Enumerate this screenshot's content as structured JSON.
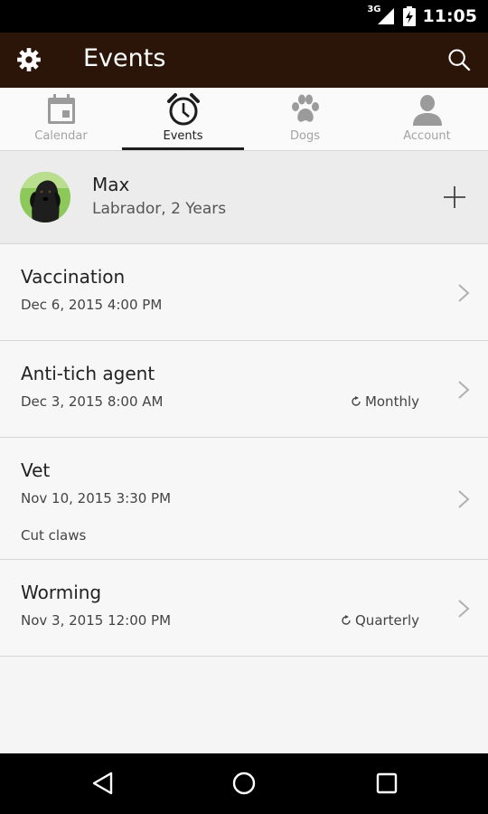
{
  "status_bar": {
    "network": "3G",
    "time": "11:05",
    "icons": [
      "signal-icon",
      "battery-charging-icon"
    ]
  },
  "app_bar": {
    "title": "Events",
    "icons": [
      "gear-icon",
      "search-icon"
    ]
  },
  "tabs": [
    {
      "label": "Calendar",
      "icon": "calendar-icon",
      "active": false
    },
    {
      "label": "Events",
      "icon": "alarm-clock-icon",
      "active": true
    },
    {
      "label": "Dogs",
      "icon": "paw-icon",
      "active": false
    },
    {
      "label": "Account",
      "icon": "person-icon",
      "active": false
    }
  ],
  "dog": {
    "name": "Max",
    "info": "Labrador, 2 Years",
    "add_icon": "plus-icon"
  },
  "events": [
    {
      "title": "Vaccination",
      "datetime": "Dec 6, 2015 4:00 PM",
      "repeat": "",
      "note": ""
    },
    {
      "title": "Anti-tich agent",
      "datetime": "Dec 3, 2015 8:00 AM",
      "repeat": "Monthly",
      "note": ""
    },
    {
      "title": "Vet",
      "datetime": "Nov 10, 2015 3:30 PM",
      "repeat": "",
      "note": "Cut claws"
    },
    {
      "title": "Worming",
      "datetime": "Nov 3, 2015 12:00 PM",
      "repeat": "Quarterly",
      "note": ""
    }
  ],
  "nav_bar": {
    "icons": [
      "back-icon",
      "home-icon",
      "recents-icon"
    ]
  },
  "colors": {
    "app_bar": "#2b1408",
    "active_tab": "#1d1d1d",
    "inactive_tab": "#a3a3a3"
  }
}
